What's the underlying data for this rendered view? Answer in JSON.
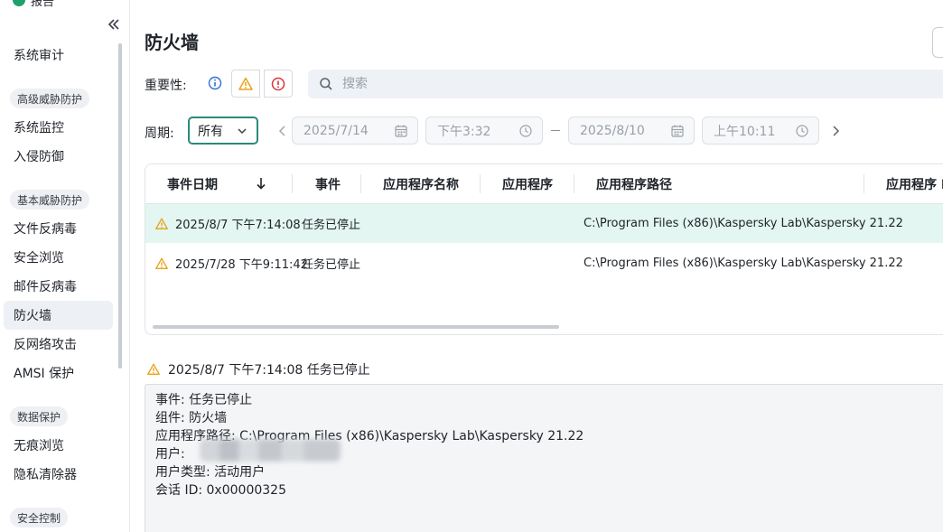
{
  "app": {
    "brand": "报告"
  },
  "sidebar": {
    "items": [
      {
        "type": "item",
        "label": "系统审计",
        "name": "sidebar-item-system-audit"
      },
      {
        "type": "group",
        "label": "高级威胁防护",
        "name": "sidebar-group-advanced-threat"
      },
      {
        "type": "item",
        "label": "系统监控",
        "name": "sidebar-item-system-watcher"
      },
      {
        "type": "item",
        "label": "入侵防御",
        "name": "sidebar-item-intrusion-prevention"
      },
      {
        "type": "group",
        "label": "基本威胁防护",
        "name": "sidebar-group-essential-threat"
      },
      {
        "type": "item",
        "label": "文件反病毒",
        "name": "sidebar-item-file-antivirus"
      },
      {
        "type": "item",
        "label": "安全浏览",
        "name": "sidebar-item-safe-browsing"
      },
      {
        "type": "item",
        "label": "邮件反病毒",
        "name": "sidebar-item-mail-antivirus"
      },
      {
        "type": "item",
        "label": "防火墙",
        "name": "sidebar-item-firewall",
        "active": true
      },
      {
        "type": "item",
        "label": "反网络攻击",
        "name": "sidebar-item-network-attack"
      },
      {
        "type": "item",
        "label": "AMSI 保护",
        "name": "sidebar-item-amsi"
      },
      {
        "type": "group",
        "label": "数据保护",
        "name": "sidebar-group-data-protection"
      },
      {
        "type": "item",
        "label": "无痕浏览",
        "name": "sidebar-item-private-browsing"
      },
      {
        "type": "item",
        "label": "隐私清除器",
        "name": "sidebar-item-privacy-cleaner"
      },
      {
        "type": "group",
        "label": "安全控制",
        "name": "sidebar-group-security-control"
      }
    ]
  },
  "header": {
    "title": "防火墙"
  },
  "filters": {
    "severity_label": "重要性:",
    "search_placeholder": "搜索",
    "period_label": "周期:",
    "period_value": "所有",
    "date_from": "2025/7/14",
    "time_from": "下午3:32",
    "date_to": "2025/8/10",
    "time_to": "上午10:11"
  },
  "table": {
    "columns": [
      "事件日期",
      "事件",
      "应用程序名称",
      "应用程序",
      "应用程序路径",
      "应用程序 P"
    ],
    "rows": [
      {
        "severity": "warning",
        "date": "2025/8/7 下午7:14:08",
        "event": "任务已停止",
        "app_name": "",
        "app": "",
        "path": "C:\\Program Files (x86)\\Kaspersky Lab\\Kaspersky 21.22",
        "selected": true
      },
      {
        "severity": "warning",
        "date": "2025/7/28 下午9:11:42",
        "event": "任务已停止",
        "app_name": "",
        "app": "",
        "path": "C:\\Program Files (x86)\\Kaspersky Lab\\Kaspersky 21.22",
        "selected": false
      }
    ]
  },
  "detail": {
    "title": "2025/8/7 下午7:14:08 任务已停止",
    "lines": [
      "事件: 任务已停止",
      "组件: 防火墙",
      "应用程序路径: C:\\Program Files (x86)\\Kaspersky Lab\\Kaspersky 21.22",
      "用户: ",
      "用户类型: 活动用户",
      "会话 ID: 0x00000325"
    ]
  },
  "colors": {
    "accent": "#2a8a7a",
    "selected_row": "#e3f6f1",
    "warning": "#e8a317",
    "critical": "#d9363e",
    "info": "#2f6fd6"
  }
}
